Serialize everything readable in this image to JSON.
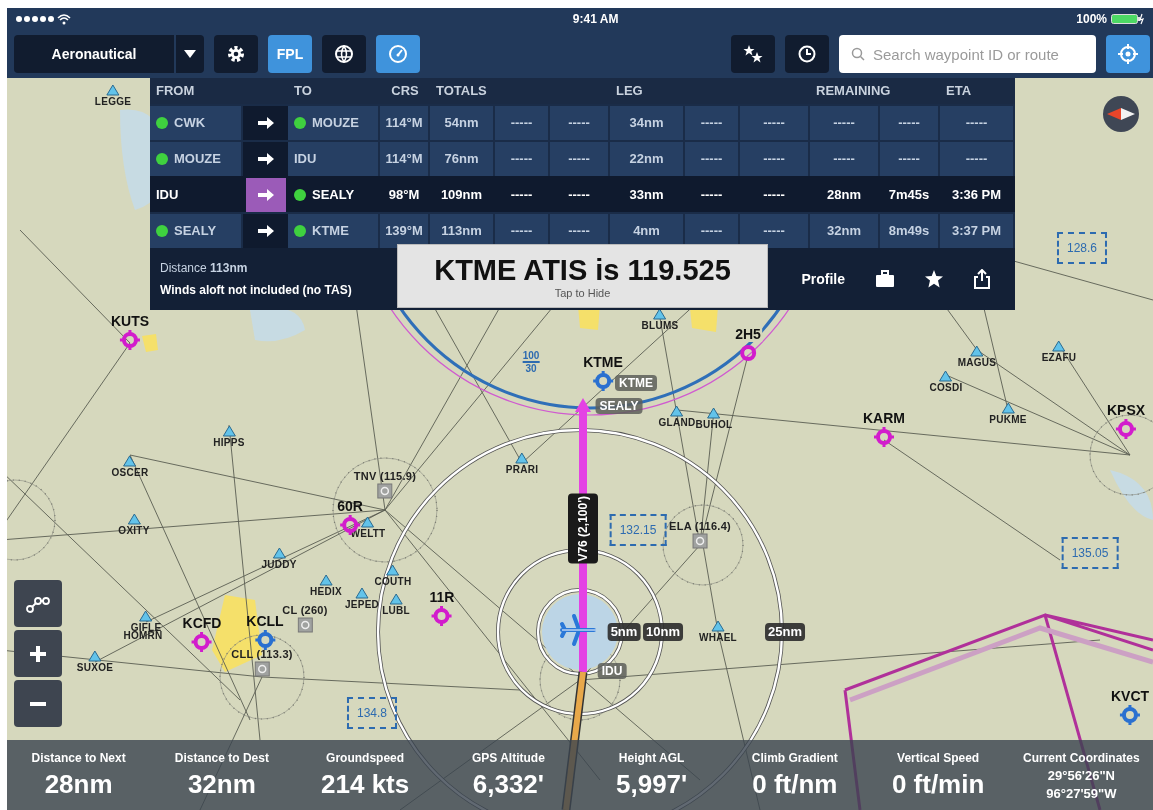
{
  "status_bar": {
    "time": "9:41 AM",
    "battery": "100%"
  },
  "toolbar": {
    "map_mode": "Aeronautical",
    "buttons": [
      {
        "kind": "settings",
        "selected": false
      },
      {
        "kind": "fpl",
        "label": "FPL",
        "selected": true
      },
      {
        "kind": "layers",
        "selected": false
      },
      {
        "kind": "gauge",
        "selected": true
      }
    ],
    "right_buttons": [
      {
        "kind": "favorites",
        "selected": false
      },
      {
        "kind": "recent",
        "selected": false
      }
    ],
    "search": {
      "placeholder": "Search waypoint ID or route"
    },
    "locate": {
      "selected": true
    }
  },
  "flight_plan": {
    "header_groups": [
      "FROM",
      "TO",
      "CRS",
      "TOTALS",
      "LEG",
      "REMAINING",
      "ETA"
    ],
    "rows": [
      {
        "from": "CWK",
        "from_dot": true,
        "to": "MOUZE",
        "to_dot": true,
        "crs": "114°M",
        "cells": [
          "54nm",
          "-----",
          "-----",
          "34nm",
          "-----",
          "-----",
          "-----",
          "-----",
          "-----"
        ],
        "selected": false
      },
      {
        "from": "MOUZE",
        "from_dot": true,
        "to": "IDU",
        "to_dot": false,
        "crs": "114°M",
        "cells": [
          "76nm",
          "-----",
          "-----",
          "22nm",
          "-----",
          "-----",
          "-----",
          "-----",
          "-----"
        ],
        "selected": false
      },
      {
        "from": "IDU",
        "from_dot": false,
        "to": "SEALY",
        "to_dot": true,
        "crs": "98°M",
        "cells": [
          "109nm",
          "-----",
          "-----",
          "33nm",
          "-----",
          "-----",
          "28nm",
          "7m45s",
          "3:36 PM"
        ],
        "selected": true
      },
      {
        "from": "SEALY",
        "from_dot": true,
        "to": "KTME",
        "to_dot": true,
        "crs": "139°M",
        "cells": [
          "113nm",
          "-----",
          "-----",
          "4nm",
          "-----",
          "-----",
          "32nm",
          "8m49s",
          "3:37 PM"
        ],
        "selected": false
      }
    ],
    "footer": {
      "distance": "Distance **113nm**",
      "note": "Winds aloft not included (no TAS)",
      "profile": "Profile"
    }
  },
  "atis_popup": {
    "title": "KTME ATIS is 119.525",
    "hint": "Tap to Hide"
  },
  "map": {
    "labels": [
      {
        "kind": "waypoint",
        "text": "LEGGE"
      },
      {
        "kind": "waypoint",
        "text": "HIPPS"
      },
      {
        "kind": "waypoint",
        "text": "OSCER"
      },
      {
        "kind": "waypoint",
        "text": "OXITY"
      },
      {
        "kind": "waypoint",
        "text": "JUDDY"
      },
      {
        "kind": "waypoint",
        "text": "HEDIX"
      },
      {
        "kind": "waypoint",
        "text": "JEPED"
      },
      {
        "kind": "waypoint",
        "text": "COUTH"
      },
      {
        "kind": "waypoint",
        "text": "LUBL"
      },
      {
        "kind": "waypoint",
        "text": "GIFLE"
      },
      {
        "kind": "name",
        "text": "HOMRN"
      },
      {
        "kind": "waypoint",
        "text": "SUXOE"
      },
      {
        "kind": "waypoint",
        "text": "WELTT"
      },
      {
        "kind": "waypoint",
        "text": "PRARI"
      },
      {
        "kind": "waypoint",
        "text": "GLAND"
      },
      {
        "kind": "waypoint",
        "text": "BUHOL"
      },
      {
        "kind": "waypoint",
        "text": "BLUMS"
      },
      {
        "kind": "waypoint",
        "text": "MAGUS"
      },
      {
        "kind": "waypoint",
        "text": "COSDI"
      },
      {
        "kind": "waypoint",
        "text": "PUKME"
      },
      {
        "kind": "waypoint",
        "text": "EZAFU"
      },
      {
        "kind": "waypoint",
        "text": "WHAEL"
      },
      {
        "kind": "airport",
        "text": "KUTS"
      },
      {
        "kind": "airport",
        "text": "60R"
      },
      {
        "kind": "airport",
        "text": "KCFD"
      },
      {
        "kind": "airport",
        "text": "11R"
      },
      {
        "kind": "heliport",
        "text": "2H5"
      },
      {
        "kind": "airport",
        "text": "KARM"
      },
      {
        "kind": "airport",
        "text": "KPSX"
      },
      {
        "kind": "towered",
        "text": "KTME"
      },
      {
        "kind": "towered",
        "text": "KCLL"
      },
      {
        "kind": "towered",
        "text": "KVCT"
      },
      {
        "kind": "vor",
        "text": "TNV (115.9)"
      },
      {
        "kind": "vor",
        "text": "ELA (116.4)"
      },
      {
        "kind": "vor",
        "text": "CLL (113.3)"
      },
      {
        "kind": "vor",
        "text": "CL (260)"
      },
      {
        "kind": "freq",
        "text": "128.6"
      },
      {
        "kind": "freq",
        "text": "132.15"
      },
      {
        "kind": "freq",
        "text": "134.8"
      },
      {
        "kind": "freq",
        "text": "135.05"
      },
      {
        "kind": "altitude",
        "text": "100",
        "lower": "30"
      },
      {
        "kind": "chip",
        "text": "KTME"
      },
      {
        "kind": "chip",
        "text": "SEALY"
      },
      {
        "kind": "chip",
        "text": "IDU"
      },
      {
        "kind": "range",
        "text": "5nm"
      },
      {
        "kind": "range",
        "text": "10nm"
      },
      {
        "kind": "range",
        "text": "25nm"
      },
      {
        "kind": "airway",
        "text": "V76 (2,100')"
      }
    ]
  },
  "map_controls": [
    {
      "kind": "route"
    },
    {
      "kind": "zoom_in"
    },
    {
      "kind": "zoom_out"
    }
  ],
  "stats": [
    {
      "label": "Distance to Next",
      "value": "28nm"
    },
    {
      "label": "Distance to Dest",
      "value": "32nm"
    },
    {
      "label": "Groundspeed",
      "value": "214 kts"
    },
    {
      "label": "GPS Altitude",
      "value": "6,332'"
    },
    {
      "label": "Height AGL",
      "value": "5,997'"
    },
    {
      "label": "Climb Gradient",
      "value": "0 ft/nm"
    },
    {
      "label": "Vertical Speed",
      "value": "0 ft/min"
    },
    {
      "label": "Current Coordinates",
      "lines": [
        "29°56'26\"N",
        "96°27'59\"W"
      ]
    }
  ]
}
